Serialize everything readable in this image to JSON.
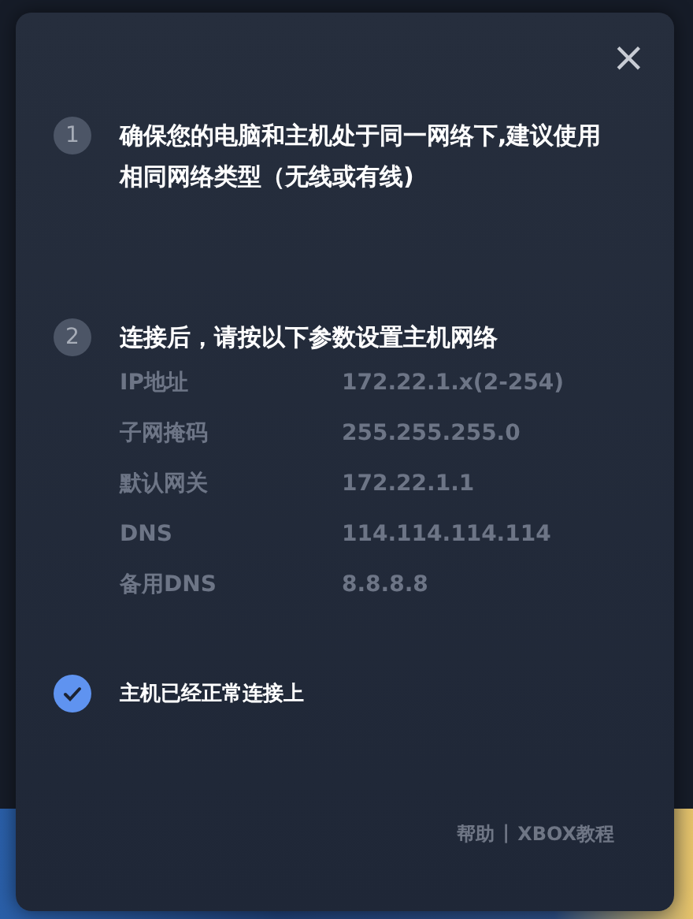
{
  "dialog": {
    "close": "×",
    "steps": [
      {
        "number": "1",
        "text": "确保您的电脑和主机处于同一网络下,建议使用相同网络类型（无线或有线)"
      },
      {
        "number": "2",
        "text": "连接后，请按以下参数设置主机网络"
      }
    ],
    "params": [
      {
        "label": "IP地址",
        "value": "172.22.1.x(2-254)"
      },
      {
        "label": "子网掩码",
        "value": "255.255.255.0"
      },
      {
        "label": "默认网关",
        "value": "172.22.1.1"
      },
      {
        "label": "DNS",
        "value": "114.114.114.114"
      },
      {
        "label": "备用DNS",
        "value": "8.8.8.8"
      }
    ],
    "status": {
      "checked": true,
      "text": "主机已经正常连接上"
    },
    "footer": {
      "links": [
        "帮助",
        "XBOX教程"
      ],
      "separator": "|"
    }
  }
}
